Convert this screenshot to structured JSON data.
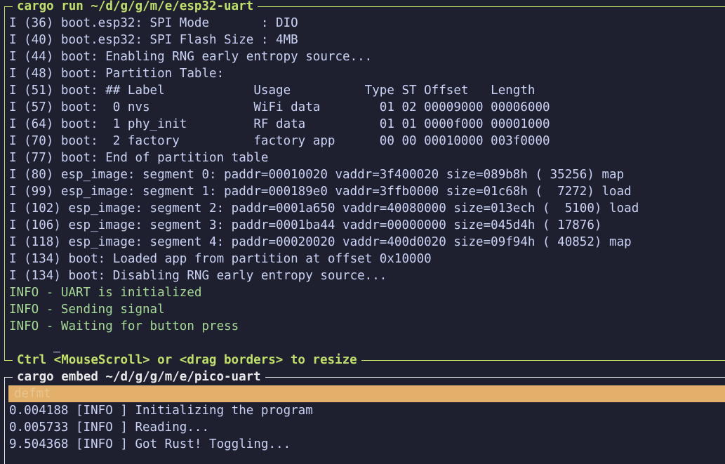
{
  "top_pane": {
    "title": "cargo run ~/d/g/g/m/e/esp32-uart",
    "footer_hint": "Ctrl <MouseScroll> or <drag borders> to resize",
    "lines": [
      "I (36) boot.esp32: SPI Mode       : DIO",
      "I (40) boot.esp32: SPI Flash Size : 4MB",
      "I (44) boot: Enabling RNG early entropy source...",
      "I (48) boot: Partition Table:",
      "I (51) boot: ## Label            Usage          Type ST Offset   Length",
      "I (57) boot:  0 nvs              WiFi data        01 02 00009000 00006000",
      "I (64) boot:  1 phy_init         RF data          01 01 0000f000 00001000",
      "I (70) boot:  2 factory          factory app      00 00 00010000 003f0000",
      "I (77) boot: End of partition table",
      "I (80) esp_image: segment 0: paddr=00010020 vaddr=3f400020 size=089b8h ( 35256) map",
      "I (99) esp_image: segment 1: paddr=000189e0 vaddr=3ffb0000 size=01c68h (  7272) load",
      "I (102) esp_image: segment 2: paddr=0001a650 vaddr=40080000 size=013ech (  5100) load",
      "I (106) esp_image: segment 3: paddr=0001ba44 vaddr=00000000 size=045d4h ( 17876)",
      "I (118) esp_image: segment 4: paddr=00020020 vaddr=400d0020 size=09f94h ( 40852) map",
      "I (134) boot: Loaded app from partition at offset 0x10000",
      "I (134) boot: Disabling RNG early entropy source..."
    ],
    "info_lines": [
      "INFO - UART is initialized",
      "INFO - Sending signal",
      "INFO - Waiting for button press"
    ]
  },
  "bottom_pane": {
    "title": "cargo embed ~/d/g/g/m/e/pico-uart",
    "tab_label": "defmt",
    "lines": [
      "0.004188 [INFO ] Initializing the program",
      "0.005733 [INFO ] Reading...",
      "9.504368 [INFO ] Got Rust! Toggling..."
    ]
  },
  "colors": {
    "background": "#1e2030",
    "active_border": "#c0e06a",
    "inactive_border": "#e8e8e8",
    "info_text": "#a6da95",
    "tab_highlight": "#e2b06a"
  }
}
